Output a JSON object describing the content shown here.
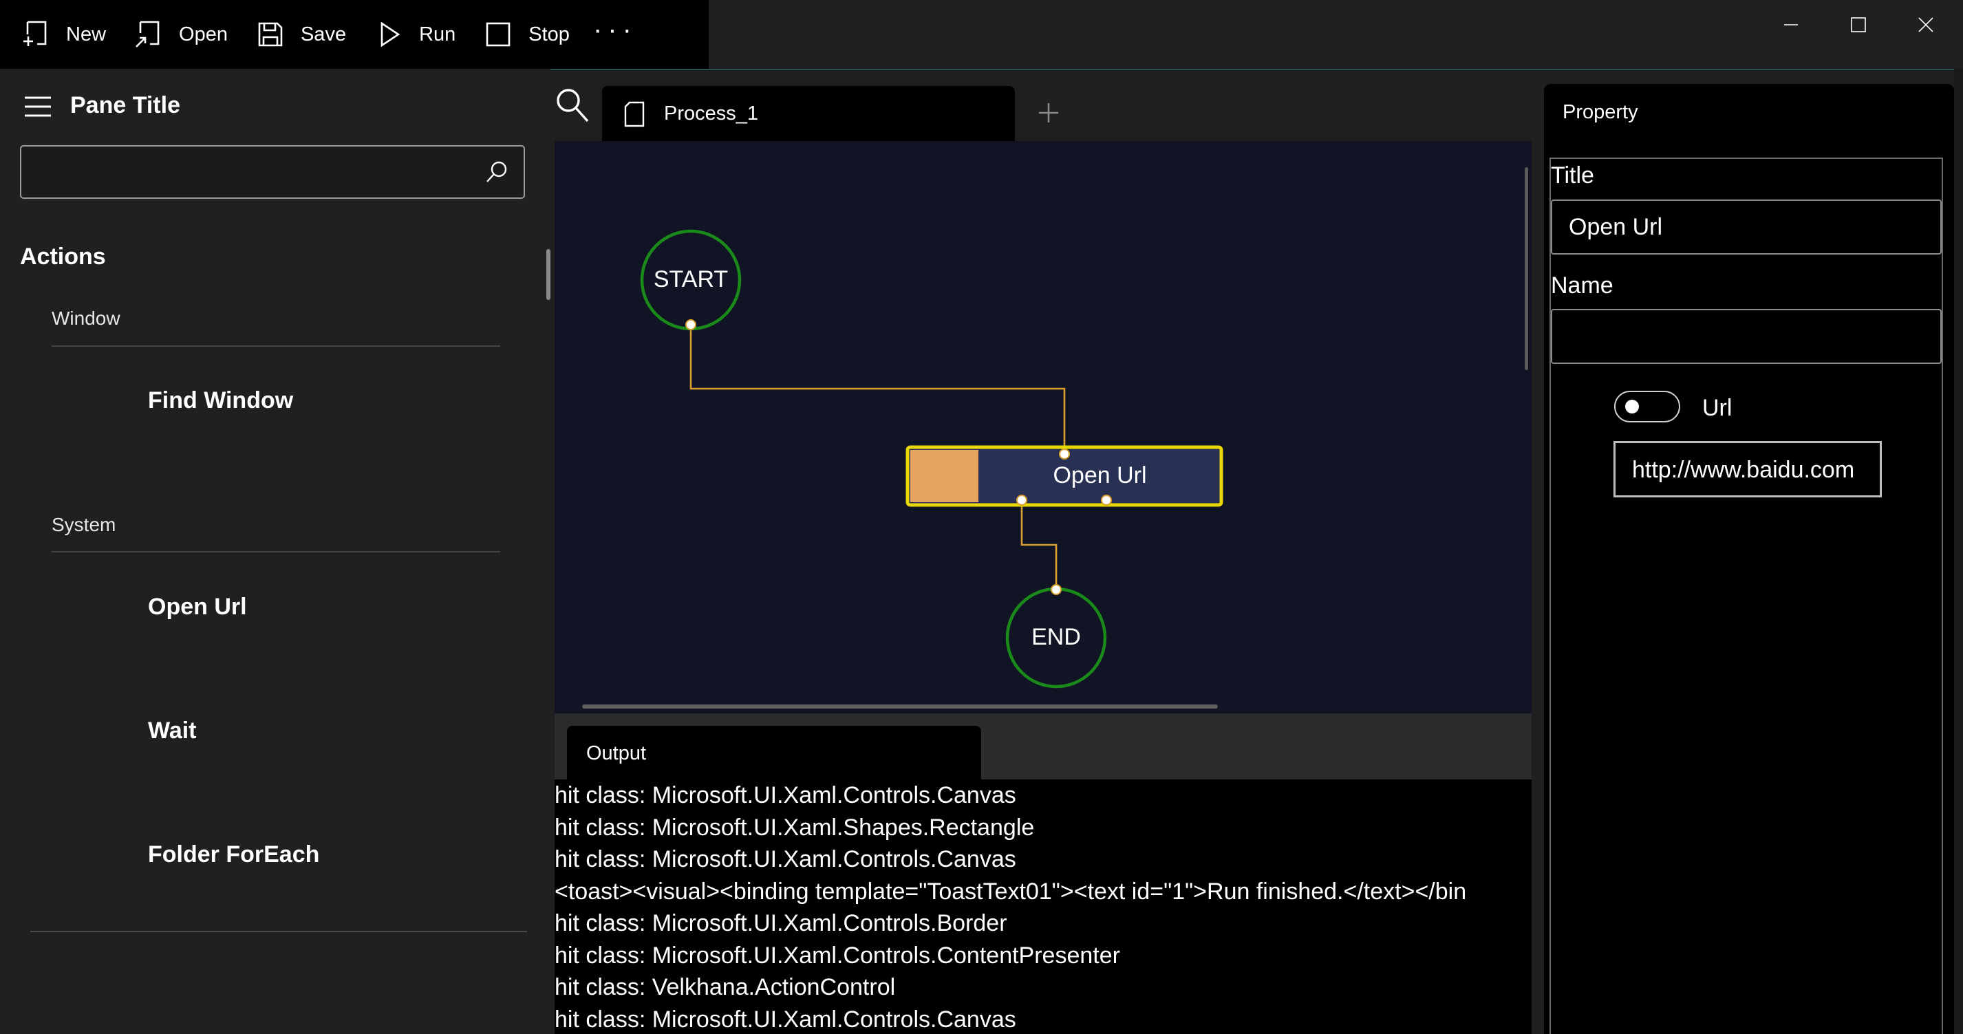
{
  "toolbar": {
    "new_label": "New",
    "open_label": "Open",
    "save_label": "Save",
    "run_label": "Run",
    "stop_label": "Stop",
    "more_label": "···"
  },
  "nav": {
    "pane_title": "Pane Title",
    "search_placeholder": "",
    "section_header": "Actions",
    "groups": [
      {
        "label": "Window",
        "items": [
          "Find Window"
        ]
      },
      {
        "label": "System",
        "items": [
          "Open Url",
          "Wait",
          "Folder ForEach"
        ]
      }
    ]
  },
  "editor": {
    "tab_name": "Process_1",
    "nodes": {
      "start": "START",
      "action": "Open Url",
      "end": "END"
    },
    "colors": {
      "start_end_ring": "#1a8a1a",
      "action_border": "#e6d800",
      "action_fill": "#283154",
      "action_accent": "#e5a560",
      "connector": "#d9a030",
      "canvas_bg": "#111425"
    }
  },
  "output": {
    "tab_label": "Output",
    "lines": [
      "hit class: Microsoft.UI.Xaml.Controls.Canvas",
      "hit class: Microsoft.UI.Xaml.Shapes.Rectangle",
      "hit class: Microsoft.UI.Xaml.Controls.Canvas",
      "<toast><visual><binding template=\"ToastText01\"><text id=\"1\">Run finished.</text></bin",
      "hit class: Microsoft.UI.Xaml.Controls.Border",
      "hit class: Microsoft.UI.Xaml.Controls.ContentPresenter",
      "hit class: Velkhana.ActionControl",
      "hit class: Microsoft.UI.Xaml.Controls.Canvas"
    ]
  },
  "properties": {
    "panel_title": "Property",
    "title_label": "Title",
    "title_value": "Open Url",
    "name_label": "Name",
    "name_value": "",
    "url_label": "Url",
    "url_value": "http://www.baidu.com",
    "url_toggle_on": false
  }
}
